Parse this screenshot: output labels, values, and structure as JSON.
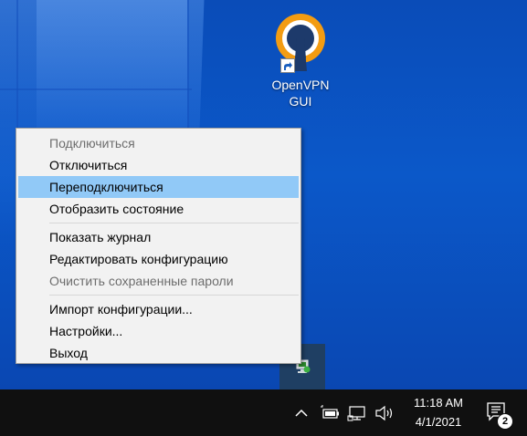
{
  "desktop": {
    "icon": {
      "label": "OpenVPN\nGUI",
      "icon_name": "openvpn-shortcut-icon"
    }
  },
  "context_menu": {
    "items": [
      {
        "label": "Подключиться",
        "disabled": true
      },
      {
        "label": "Отключиться",
        "disabled": false
      },
      {
        "label": "Переподключиться",
        "disabled": false,
        "highlighted": true
      },
      {
        "label": "Отобразить состояние",
        "disabled": false
      },
      {
        "label": "Показать журнал",
        "disabled": false
      },
      {
        "label": "Редактировать конфигурацию",
        "disabled": false
      },
      {
        "label": "Очистить сохраненные пароли",
        "disabled": true
      },
      {
        "label": "Импорт конфигурации...",
        "disabled": false
      },
      {
        "label": "Настройки...",
        "disabled": false
      },
      {
        "label": "Выход",
        "disabled": false
      }
    ],
    "highlight_color": "#91c9f7"
  },
  "tray_overflow": {
    "icon_name": "openvpn-tray-icon"
  },
  "taskbar": {
    "icons": [
      "chevron-up-icon",
      "battery-icon",
      "network-icon",
      "volume-icon"
    ],
    "clock": {
      "time": "11:18 AM",
      "date": "4/1/2021"
    },
    "notifications": {
      "icon_name": "action-center-icon",
      "count": "2"
    }
  }
}
